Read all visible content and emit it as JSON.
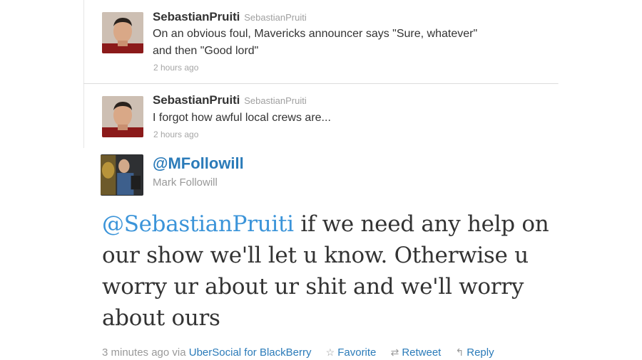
{
  "tweets": [
    {
      "user": "SebastianPruiti",
      "handle": "SebastianPruiti",
      "text_line1": "On an obvious foul, Mavericks announcer says \"Sure, whatever\"",
      "text_line2": "and then \"Good lord\"",
      "time": "2 hours ago"
    },
    {
      "user": "SebastianPruiti",
      "handle": "SebastianPruiti",
      "text_line1": "I forgot how awful local crews are...",
      "time": "2 hours ago"
    }
  ],
  "reply_tweet": {
    "handle": "@MFollowill",
    "full_name": "Mark Followill",
    "mention": "@SebastianPruiti",
    "text": " if we need any help on our show we'll let u know. Otherwise u worry ur about ur shit and we'll worry about ours",
    "time": "3 minutes ago via",
    "client": "UberSocial for BlackBerry",
    "actions": {
      "favorite": "Favorite",
      "retweet": "Retweet",
      "reply": "Reply"
    },
    "icons": {
      "favorite": "star-icon",
      "retweet": "retweet-icon",
      "reply": "reply-arrow-icon"
    }
  },
  "colors": {
    "link": "#2b7bb9",
    "mention": "#3b94d9",
    "muted": "#a6a6a6"
  }
}
